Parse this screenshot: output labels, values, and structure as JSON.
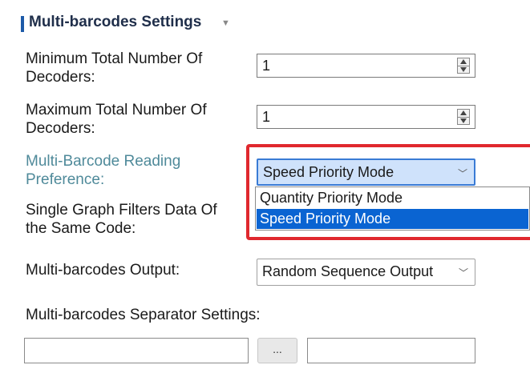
{
  "section": {
    "title": "Multi-barcodes Settings",
    "collapse_icon": "caret-down-icon"
  },
  "min_decoders": {
    "label_line1": "Minimum Total Number Of",
    "label_line2": "Decoders:",
    "value": "1"
  },
  "max_decoders": {
    "label_line1": "Maximum Total Number Of",
    "label_line2": "Decoders:",
    "value": "1"
  },
  "reading_preference": {
    "label_line1": "Multi-Barcode Reading",
    "label_line2": "Preference:",
    "selected": "Speed Priority Mode",
    "options": [
      "Quantity Priority Mode",
      "Speed Priority Mode"
    ],
    "label_color": "#4f8a9a"
  },
  "single_graph_filter": {
    "label_line1": "Single Graph Filters Data Of",
    "label_line2": "the Same Code:"
  },
  "output": {
    "label": "Multi-barcodes Output:",
    "selected": "Random Sequence Output"
  },
  "separator": {
    "label": "Multi-barcodes Separator Settings:",
    "browse_label": "...",
    "field1_value": "",
    "field2_value": ""
  },
  "colors": {
    "accent": "#1d5aa8",
    "selection": "#0a64d2",
    "highlight_box": "#e0282e"
  }
}
